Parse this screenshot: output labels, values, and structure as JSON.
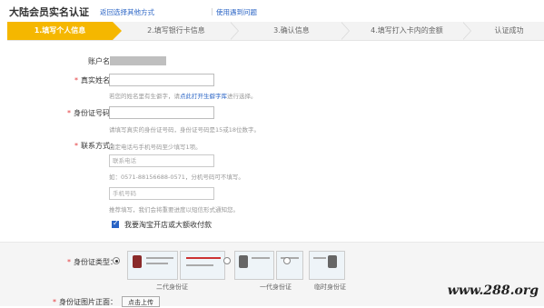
{
  "header": {
    "title": "大陆会员实名认证",
    "link_back": "返回选择其他方式",
    "divider": "|",
    "link_help": "使用遇到问题"
  },
  "steps": [
    {
      "label": "1.填写个人信息",
      "active": true
    },
    {
      "label": "2.填写银行卡信息",
      "active": false
    },
    {
      "label": "3.确认信息",
      "active": false
    },
    {
      "label": "4.填写打入卡内的金额",
      "active": false
    },
    {
      "label": "认证成功",
      "active": false
    }
  ],
  "form": {
    "account_label": "账户名：",
    "name_label": "真实姓名：",
    "name_hint_prefix": "若您的姓名里有生僻字，请",
    "name_hint_link": "点此打开生僻字库",
    "name_hint_suffix": "进行选择。",
    "id_label": "身份证号码：",
    "id_hint": "请填写真实的身份证号码，身份证号码是15或18位数字。",
    "contact_label": "联系方式：",
    "contact_hint": "固定电话与手机号码至少填写1项。",
    "phone_placeholder": "联系电话",
    "phone_hint": "如：0571-88156688-0571，分机号码可不填写。",
    "mobile_placeholder": "手机号码",
    "mobile_hint": "推荐填写，我们会将重要进度以短信形式通知您。",
    "checkbox_label": "我要淘宝开店或大额收付款",
    "id_type_label": "身份证类型：",
    "id_types": [
      {
        "caption": "二代身份证",
        "checked": true
      },
      {
        "caption": "一代身份证",
        "checked": false
      },
      {
        "caption": "临时身份证",
        "checked": false
      }
    ],
    "id_photo_label": "身份证图片正面：",
    "upload_label": "点击上传"
  },
  "watermark": "www.288.org",
  "colors": {
    "accent": "#f5b700",
    "link": "#2a64c5",
    "required": "#e4393c"
  }
}
